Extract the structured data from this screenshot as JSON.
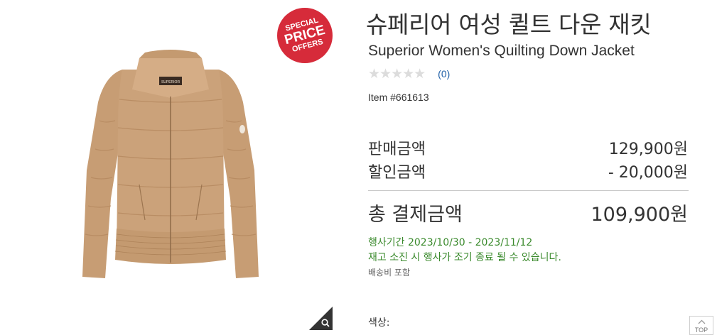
{
  "badge": {
    "line1": "SPECIAL",
    "line2": "PRICE",
    "line3": "OFFERS",
    "color": "#d62b3a"
  },
  "jacket": {
    "brand_tag": "SUPERIOR"
  },
  "product": {
    "title_ko": "슈페리어 여성 퀼트 다운 재킷",
    "title_en": "Superior Women's Quilting Down Jacket",
    "rating": {
      "stars": "★★★★★",
      "count": "(0)"
    },
    "item_number": "Item #661613"
  },
  "pricing": {
    "sale_label": "판매금액",
    "sale_value": "129,900원",
    "discount_label": "할인금액",
    "discount_value": "- 20,000원",
    "total_label": "총 결제금액",
    "total_value": "109,900원"
  },
  "event": {
    "period": "행사기간 2023/10/30 - 2023/11/12",
    "notice": "재고 소진 시 행사가 조기 종료 될 수 있습니다.",
    "color": "#3a8a2c"
  },
  "shipping": "배송비 포함",
  "options": {
    "color_label": "색상:"
  },
  "top_button": {
    "label": "TOP"
  },
  "icons": {
    "zoom": "magnifier-icon",
    "top": "chevron-up-icon",
    "rating": "star-icon"
  }
}
